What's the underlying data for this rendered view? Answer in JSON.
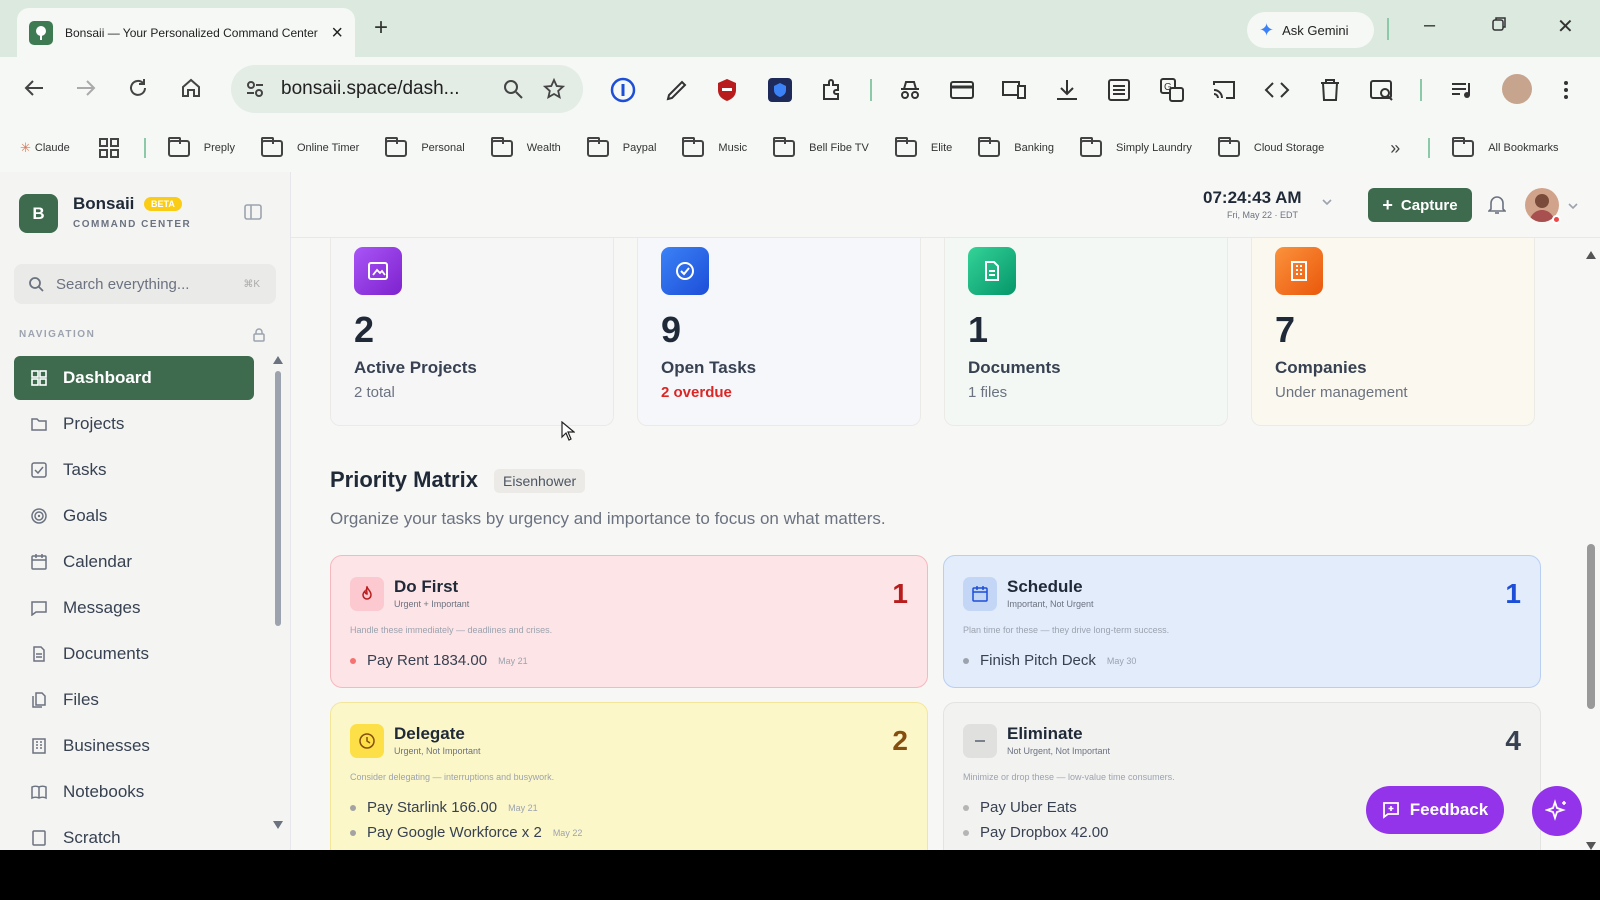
{
  "browser": {
    "tab_title": "Bonsaii — Your Personalized Command Center",
    "new_tab": "+",
    "ask_gemini": "Ask Gemini",
    "url": "bonsaii.space/dash...",
    "bookmarks": [
      "Claude",
      "Preply",
      "Online Timer",
      "Personal",
      "Wealth",
      "Paypal",
      "Music",
      "Bell Fibe TV",
      "Elite",
      "Banking",
      "Simply Laundry",
      "Cloud Storage"
    ],
    "all_bookmarks": "All Bookmarks"
  },
  "sidebar": {
    "logo_letter": "B",
    "brand": "Bonsaii",
    "beta": "BETA",
    "subtitle": "COMMAND CENTER",
    "search_placeholder": "Search everything...",
    "search_shortcut": "⌘K",
    "nav_label": "NAVIGATION",
    "items": [
      {
        "label": "Dashboard",
        "icon": "grid-icon",
        "active": true
      },
      {
        "label": "Projects",
        "icon": "folder-icon"
      },
      {
        "label": "Tasks",
        "icon": "checkbox-icon"
      },
      {
        "label": "Goals",
        "icon": "target-icon"
      },
      {
        "label": "Calendar",
        "icon": "calendar-icon"
      },
      {
        "label": "Messages",
        "icon": "chat-icon"
      },
      {
        "label": "Documents",
        "icon": "document-icon"
      },
      {
        "label": "Files",
        "icon": "files-icon"
      },
      {
        "label": "Businesses",
        "icon": "building-icon"
      },
      {
        "label": "Notebooks",
        "icon": "book-icon"
      },
      {
        "label": "Scratch",
        "icon": "scratch-icon"
      }
    ]
  },
  "header": {
    "time": "07:24:43 AM",
    "date": "Fri, May 22 · EDT",
    "capture": "Capture"
  },
  "stats": [
    {
      "value": "2",
      "label": "Active Projects",
      "sub": "2 total",
      "color": "#9333ea",
      "bg": "#f7f6f7"
    },
    {
      "value": "9",
      "label": "Open Tasks",
      "sub": "2 overdue",
      "sub_color": "#dc2626",
      "color": "#2563eb",
      "bg": "#f5f7fa"
    },
    {
      "value": "1",
      "label": "Documents",
      "sub": "1 files",
      "color": "#10b981",
      "bg": "#f3f8f4"
    },
    {
      "value": "7",
      "label": "Companies",
      "sub": "Under management",
      "color": "#f97316",
      "bg": "#fbf9ef"
    }
  ],
  "matrix": {
    "title": "Priority Matrix",
    "tag": "Eisenhower",
    "description": "Organize your tasks by urgency and importance to focus on what matters.",
    "quadrants": [
      {
        "title": "Do First",
        "subtitle": "Urgent + Important",
        "count": "1",
        "desc": "Handle these immediately — deadlines and crises.",
        "items": [
          {
            "text": "Pay Rent 1834.00",
            "date": "May 21"
          }
        ],
        "accent": "#b91c1c",
        "bg": "#fde4e6",
        "border": "#f6b8be"
      },
      {
        "title": "Schedule",
        "subtitle": "Important, Not Urgent",
        "count": "1",
        "desc": "Plan time for these — they drive long-term success.",
        "items": [
          {
            "text": "Finish Pitch Deck",
            "date": "May 30"
          }
        ],
        "accent": "#1d4ed8",
        "bg": "#e2ecfb",
        "border": "#b9cff1"
      },
      {
        "title": "Delegate",
        "subtitle": "Urgent, Not Important",
        "count": "2",
        "desc": "Consider delegating — interruptions and busywork.",
        "items": [
          {
            "text": "Pay Starlink 166.00",
            "date": "May 21"
          },
          {
            "text": "Pay Google Workforce x 2",
            "date": "May 22"
          }
        ],
        "accent": "#854d0e",
        "bg": "#fcf7c9",
        "border": "#f3e69a"
      },
      {
        "title": "Eliminate",
        "subtitle": "Not Urgent, Not Important",
        "count": "4",
        "desc": "Minimize or drop these — low-value time consumers.",
        "items": [
          {
            "text": "Pay Uber Eats",
            "date": ""
          },
          {
            "text": "Pay Dropbox 42.00",
            "date": ""
          }
        ],
        "accent": "#374151",
        "bg": "#f2f2f1",
        "border": "#e3e3e1"
      }
    ]
  },
  "feedback": "Feedback"
}
